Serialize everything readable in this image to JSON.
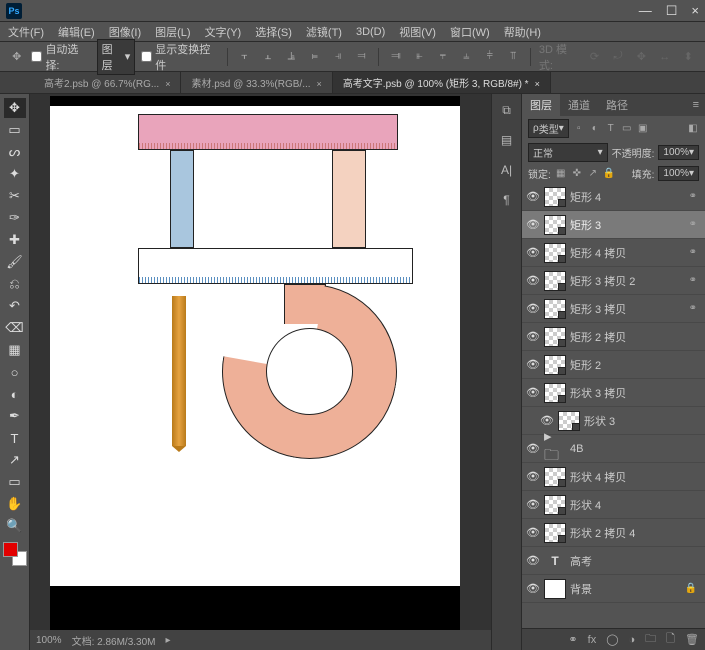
{
  "app": {
    "logo": "Ps"
  },
  "window": {
    "min": "—",
    "max": "☐",
    "close": "×"
  },
  "menu": {
    "file": "文件(F)",
    "edit": "编辑(E)",
    "image": "图像(I)",
    "layer": "图层(L)",
    "type": "文字(Y)",
    "select": "选择(S)",
    "filter": "滤镜(T)",
    "threeD": "3D(D)",
    "view": "视图(V)",
    "window": "窗口(W)",
    "help": "帮助(H)"
  },
  "options": {
    "autoselect": "自动选择:",
    "group": "图层",
    "showtransform": "显示变换控件",
    "mode3d": "3D 模式:"
  },
  "tabs": [
    {
      "label": "高考2.psb @ 66.7%(RG...",
      "active": false
    },
    {
      "label": "素材.psd @ 33.3%(RGB/...",
      "active": false
    },
    {
      "label": "高考文字.psb @ 100% (矩形 3, RGB/8#) *",
      "active": true
    }
  ],
  "status": {
    "zoom": "100%",
    "docinfo": "文档: 2.86M/3.30M"
  },
  "panel": {
    "tabs": {
      "layers": "图层",
      "channels": "通道",
      "paths": "路径"
    },
    "kind": "类型",
    "blend": "正常",
    "opacity_lbl": "不透明度:",
    "opacity_val": "100%",
    "lock_lbl": "锁定:",
    "fill_lbl": "填充:",
    "fill_val": "100%"
  },
  "layers": [
    {
      "name": "矩形 4",
      "thumb": "checker",
      "link": true
    },
    {
      "name": "矩形 3",
      "thumb": "checker",
      "link": true,
      "sel": true
    },
    {
      "name": "矩形 4 拷贝",
      "thumb": "checker",
      "link": true
    },
    {
      "name": "矩形 3 拷贝 2",
      "thumb": "checker",
      "link": true
    },
    {
      "name": "矩形 3 拷贝",
      "thumb": "checker",
      "link": true
    },
    {
      "name": "矩形 2 拷贝",
      "thumb": "checker"
    },
    {
      "name": "矩形 2",
      "thumb": "checker"
    },
    {
      "name": "形状 3 拷贝",
      "thumb": "checker"
    },
    {
      "name": "形状 3",
      "thumb": "checker",
      "indent": true
    },
    {
      "name": "4B",
      "thumb": "folder"
    },
    {
      "name": "形状 4 拷贝",
      "thumb": "checker"
    },
    {
      "name": "形状 4",
      "thumb": "checker"
    },
    {
      "name": "形状 2 拷贝 4",
      "thumb": "checker"
    },
    {
      "name": "高考",
      "thumb": "text"
    },
    {
      "name": "背景",
      "thumb": "white",
      "lock": true
    }
  ],
  "icons": {
    "eye": "👁",
    "link": "⚭",
    "lock": "🔒",
    "caret": "▾",
    "x": "×",
    "move": "✥",
    "marquee": "▭",
    "lasso": "ᔕ",
    "wand": "✦",
    "crop": "✂",
    "eyedrop": "✑",
    "heal": "✚",
    "brush": "🖌",
    "stamp": "⎌",
    "history": "↶",
    "eraser": "⌫",
    "grad": "▦",
    "blur": "○",
    "dodge": "◐",
    "pen": "✒",
    "text": "T",
    "path": "↗",
    "rect": "▭",
    "hand": "✋",
    "zoom": "🔍",
    "arrow": "▸"
  }
}
